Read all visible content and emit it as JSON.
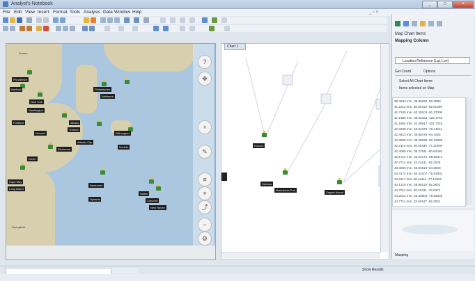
{
  "window": {
    "title": "Analyst's Notebook"
  },
  "menu": [
    "File",
    "Edit",
    "View",
    "Insert",
    "Format",
    "Tools",
    "Analysis",
    "Data",
    "Window",
    "Help"
  ],
  "map": {
    "labels": [
      "Boston",
      "Providence",
      "Hartford",
      "New York",
      "Philadelphia",
      "Baltimore",
      "Washington",
      "Portland",
      "Albany",
      "Trenton",
      "Newark",
      "Wilmington",
      "Atlantic City",
      "Norfolk",
      "Richmond",
      "Dover",
      "Cape May",
      "Long Island",
      "Nantucket",
      "Hyannis",
      "Salem",
      "Concord",
      "New Haven",
      "Springfield"
    ]
  },
  "graph": {
    "tab": "Chart 1",
    "node_labels": [
      "Kosovo",
      "Zelenka",
      "Macedonia Port",
      "Zagreb Airport"
    ]
  },
  "right_panel": {
    "header": "Map Chart Items",
    "subheader": "Mapping Column",
    "dropdown": "Location Reference (Lat, Lon)",
    "tabs": [
      "Get Coord.",
      "Options"
    ],
    "checkbox": "Select All Chart Items",
    "note": "Items selected on Map",
    "rows": [
      "39.4843 mm.  39.89193 -80.3980",
      "41.2211 mm.  38.30413 -52.61000",
      "41.7340 mm.  40.29104 -81.37000",
      "41.1300 mm.  38.29183 -122.1746",
      "41.1804 mm.  32.29917 -101.7322",
      "42.3345 mm.  40.04373 -76.14211",
      "42.4413 mm.  38.86479 -64.4344",
      "42.3500 mm.  38.28039 -92.12000",
      "42.2114 mm.  38.40430 -74.11009",
      "42.4000 mm.  38.27911 -80.84348",
      "42.1714 mm.  33.24171 -88.82371",
      "42.7711 mm.  33.24141 -82.2225",
      "43.4003 mm.  38.34813 -94.8830",
      "43.4174 mm.  30.43107 -75.91901",
      "43.2117 mm.  38.44111 -77.12001",
      "43.1210 mm.  38.88110 -92.2831",
      "44.7011 mm.  38.40431 -78.6371",
      "44.2012 mm.  38.30804 -75.82001",
      "44.7711 mm.  33.40447 -82.2021"
    ],
    "bottom_tab": "Mapping"
  },
  "status": {
    "right": "Show Results"
  }
}
